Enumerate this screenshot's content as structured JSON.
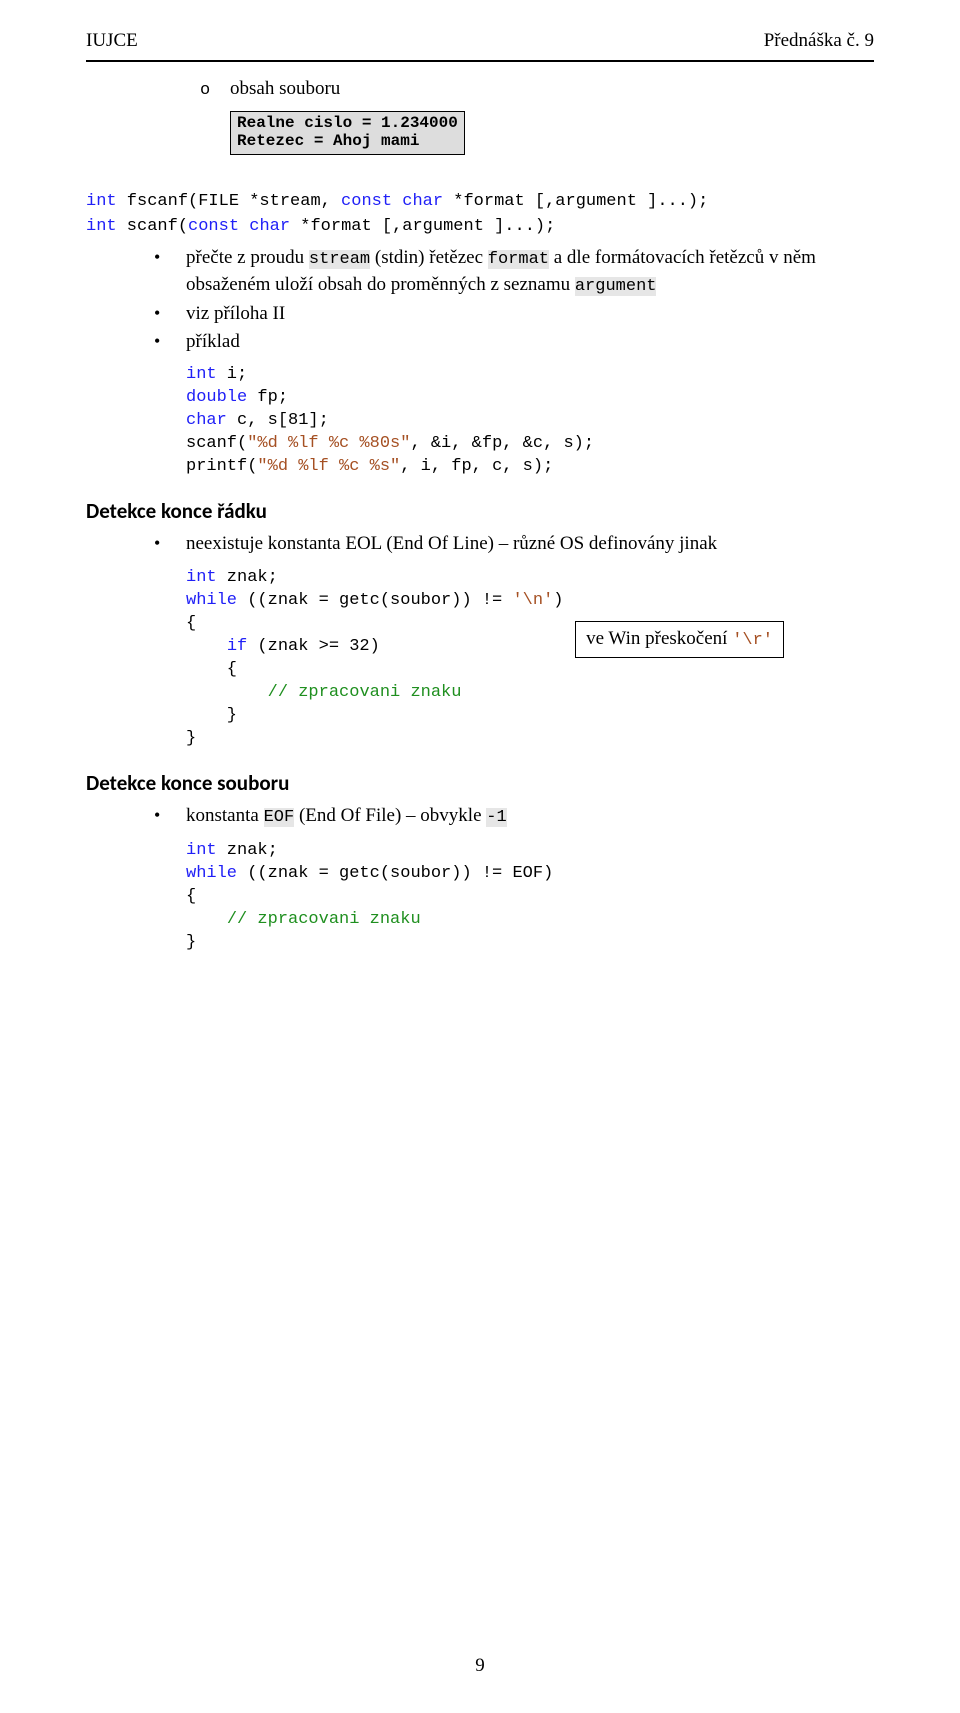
{
  "header": {
    "left": "IUJCE",
    "right": "Přednáška č. 9"
  },
  "section1": {
    "o_label": "o",
    "o_text": "obsah souboru",
    "console_l1": "Realne cislo = 1.234000",
    "console_l2": "Retezec = Ahoj mami"
  },
  "fscanf": {
    "line1_a": "int",
    "line1_b": " fscanf(FILE *stream, ",
    "line1_c": "const",
    "line1_d": " ",
    "line1_e": "char",
    "line1_f": " *format [,argument ]...);",
    "line2_a": "int",
    "line2_b": " scanf(",
    "line2_c": "const",
    "line2_d": " ",
    "line2_e": "char",
    "line2_f": " *format [,argument ]...);",
    "bul1_pre": "přečte z proudu ",
    "bul1_stream": "stream",
    "bul1_mid1": " (stdin) řetězec ",
    "bul1_format": "format",
    "bul1_mid2": " a dle formátovacích řetězců v něm obsaženém uloží obsah do proměnných z seznamu ",
    "bul1_arg": "argument",
    "bul2": "viz příloha II",
    "bul3": "příklad",
    "code": {
      "l1_a": "int",
      "l1_b": " i;",
      "l2_a": "double",
      "l2_b": " fp;",
      "l3_a": "char",
      "l3_b": " c, s[81];",
      "l4_a": "scanf(",
      "l4_b": "\"%d %lf %c %80s\"",
      "l4_c": ", &i, &fp, &c, s);",
      "l5_a": "printf(",
      "l5_b": "\"%d %lf %c %s\"",
      "l5_c": ", i, fp, c, s);"
    }
  },
  "lineEnd": {
    "heading": "Detekce konce řádku",
    "bul1": "neexistuje konstanta EOL (End Of Line) – různé OS definovány jinak",
    "code": {
      "l1_a": "int",
      "l1_b": " znak;",
      "l2_a": "while",
      "l2_b": " ((znak = getc(soubor)) != ",
      "l2_c": "'\\n'",
      "l2_d": ")",
      "l3": "{",
      "l4_a": "    ",
      "l4_b": "if",
      "l4_c": " (znak >= 32)",
      "l5": "    {",
      "l6_a": "        ",
      "l6_b": "// zpracovani znaku",
      "l7": "    }",
      "l8": "}"
    },
    "sidebox_pre": "ve Win přeskočení ",
    "sidebox_code": "'\\r'"
  },
  "eof": {
    "heading": "Detekce konce souboru",
    "bul1_pre": "konstanta ",
    "bul1_eof": "EOF",
    "bul1_mid": " (End Of File) – obvykle ",
    "bul1_neg1": "-1",
    "code": {
      "l1_a": "int",
      "l1_b": " znak;",
      "l2_a": "while",
      "l2_b": " ((znak = getc(soubor)) != EOF)",
      "l3": "{",
      "l4_a": "    ",
      "l4_b": "// zpracovani znaku",
      "l5": "}"
    }
  },
  "page_number": "9"
}
